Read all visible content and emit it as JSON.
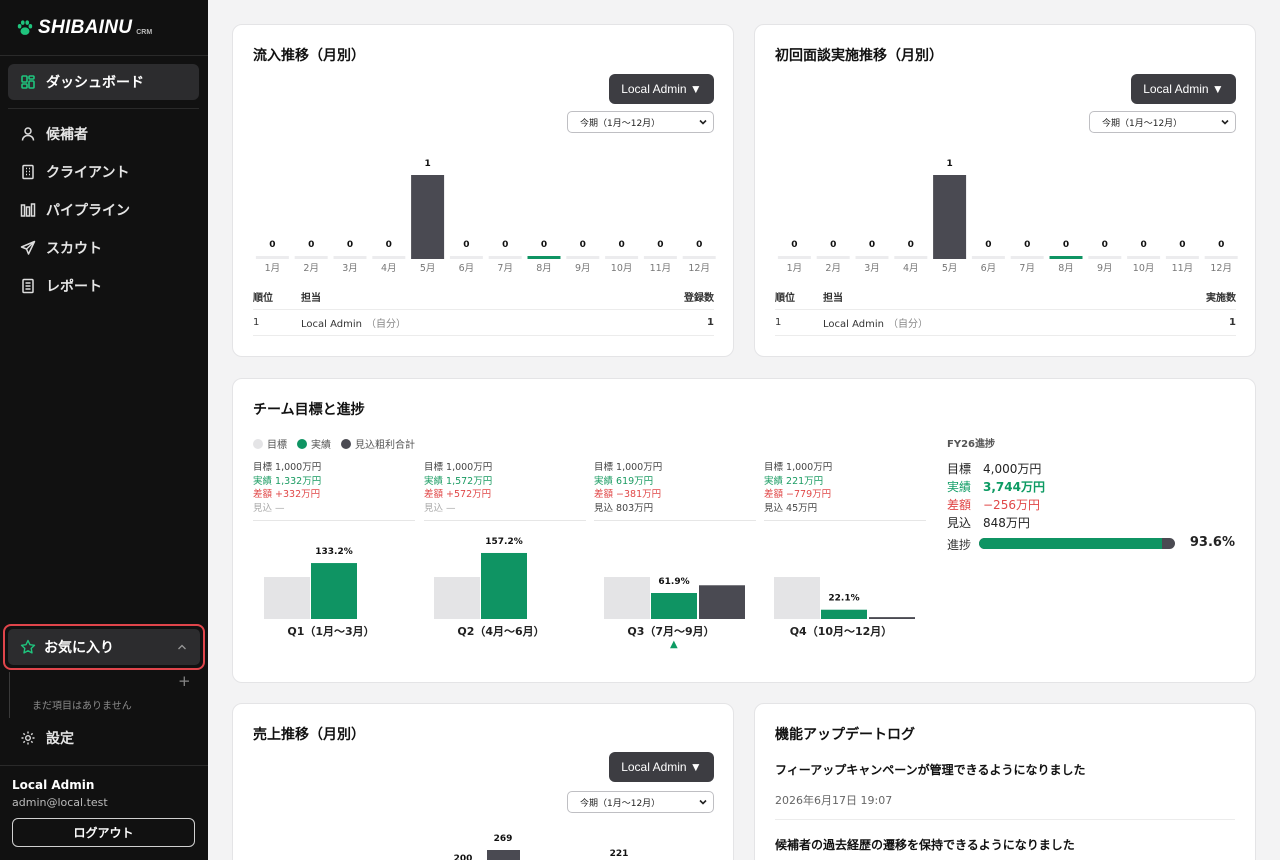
{
  "brand": {
    "name": "SHIBAINU",
    "sub": "CRM"
  },
  "sidebar": {
    "items": [
      {
        "label": "ダッシュボード",
        "icon": "dashboard-icon",
        "active": true
      },
      {
        "label": "候補者",
        "icon": "person-icon"
      },
      {
        "label": "クライアント",
        "icon": "building-icon"
      },
      {
        "label": "パイプライン",
        "icon": "pipeline-icon"
      },
      {
        "label": "スカウト",
        "icon": "send-icon"
      },
      {
        "label": "レポート",
        "icon": "report-icon"
      }
    ],
    "favorites": {
      "label": "お気に入り",
      "add": "+",
      "empty": "まだ項目はありません"
    },
    "settings": "設定",
    "user": {
      "name": "Local Admin",
      "email": "admin@local.test"
    },
    "logout": "ログアウト"
  },
  "colors": {
    "accent": "#0f9463",
    "dark_bar": "#4a4a52",
    "target_bar": "#e4e4e6",
    "danger": "#e04848"
  },
  "inflow": {
    "title": "流入推移（月別）",
    "user_select": "Local Admin ▼",
    "period": "今期（1月〜12月）",
    "table": {
      "headers": [
        "順位",
        "担当",
        "登録数"
      ],
      "rows": [
        [
          "1",
          "Local Admin",
          "（自分）",
          "1"
        ]
      ]
    }
  },
  "interview": {
    "title": "初回面談実施推移（月別）",
    "user_select": "Local Admin ▼",
    "period": "今期（1月〜12月）",
    "table": {
      "headers": [
        "順位",
        "担当",
        "実施数"
      ],
      "rows": [
        [
          "1",
          "Local Admin",
          "（自分）",
          "1"
        ]
      ]
    }
  },
  "team": {
    "title": "チーム目標と進捗",
    "legend": [
      "目標",
      "実績",
      "見込粗利合計"
    ],
    "quarters": [
      {
        "target": "目標 1,000万円",
        "actual": "実績 1,332万円",
        "diff": "差額 +332万円",
        "forecast": "見込 —",
        "pct": "133.2%",
        "label": "Q1（1月〜3月）",
        "current": false
      },
      {
        "target": "目標 1,000万円",
        "actual": "実績 1,572万円",
        "diff": "差額 +572万円",
        "forecast": "見込 —",
        "pct": "157.2%",
        "label": "Q2（4月〜6月）",
        "current": false
      },
      {
        "target": "目標 1,000万円",
        "actual": "実績 619万円",
        "diff": "差額 −381万円",
        "forecast": "見込 803万円",
        "pct": "61.9%",
        "label": "Q3（7月〜9月）",
        "current": true
      },
      {
        "target": "目標 1,000万円",
        "actual": "実績 221万円",
        "diff": "差額 −779万円",
        "forecast": "見込 45万円",
        "pct": "22.1%",
        "label": "Q4（10月〜12月）",
        "current": false
      }
    ],
    "current_marker": "▲",
    "fy": {
      "title": "FY26進捗",
      "target_k": "目標",
      "target_v": "4,000万円",
      "actual_k": "実績",
      "actual_v": "3,744万円",
      "diff_k": "差額",
      "diff_v": "−256万円",
      "forecast_k": "見込",
      "forecast_v": "848万円",
      "progress_k": "進捗",
      "progress_pct": "93.6%",
      "progress_fraction": 0.936
    }
  },
  "sales": {
    "title": "売上推移（月別）",
    "user_select": "Local Admin ▼",
    "period": "今期（1月〜12月）"
  },
  "updates": {
    "title": "機能アップデートログ",
    "items": [
      {
        "title": "フィーアップキャンペーンが管理できるようになりました",
        "date": "2026年6月17日 19:07"
      },
      {
        "title": "候補者の過去経歴の遷移を保持できるようになりました",
        "date": ""
      }
    ]
  },
  "chart_data": [
    {
      "type": "bar",
      "categories": [
        "1月",
        "2月",
        "3月",
        "4月",
        "5月",
        "6月",
        "7月",
        "8月",
        "9月",
        "10月",
        "11月",
        "12月"
      ],
      "values": [
        0,
        0,
        0,
        0,
        1,
        0,
        0,
        0,
        0,
        0,
        0,
        0
      ],
      "title": "流入推移（月別）",
      "highlight_category": "8月",
      "ylim": [
        0,
        1
      ]
    },
    {
      "type": "bar",
      "categories": [
        "1月",
        "2月",
        "3月",
        "4月",
        "5月",
        "6月",
        "7月",
        "8月",
        "9月",
        "10月",
        "11月",
        "12月"
      ],
      "values": [
        0,
        0,
        0,
        0,
        1,
        0,
        0,
        0,
        0,
        0,
        0,
        0
      ],
      "title": "初回面談実施推移（月別）",
      "highlight_category": "8月",
      "ylim": [
        0,
        1
      ]
    },
    {
      "type": "bar",
      "title": "チーム目標と進捗",
      "categories": [
        "Q1（1月〜3月）",
        "Q2（4月〜6月）",
        "Q3（7月〜9月）",
        "Q4（10月〜12月）"
      ],
      "series": [
        {
          "name": "目標",
          "values": [
            1000,
            1000,
            1000,
            1000
          ]
        },
        {
          "name": "実績",
          "values": [
            1332,
            1572,
            619,
            221
          ]
        },
        {
          "name": "見込粗利合計",
          "values": [
            0,
            0,
            803,
            45
          ]
        }
      ],
      "data_labels": [
        "133.2%",
        "157.2%",
        "61.9%",
        "22.1%"
      ]
    },
    {
      "type": "bar",
      "title": "売上推移（月別）",
      "partial_values_visible": [
        200,
        269,
        221
      ]
    }
  ]
}
